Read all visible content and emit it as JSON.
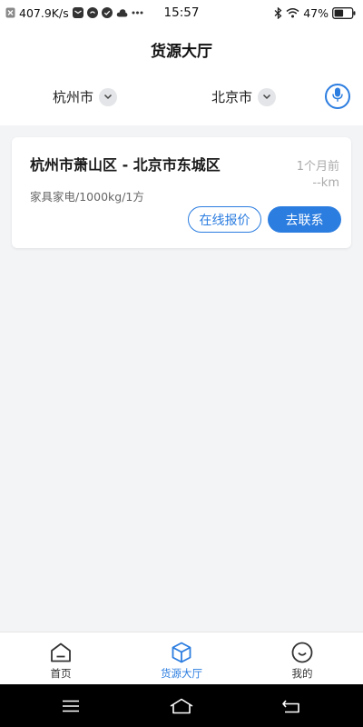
{
  "status_bar": {
    "net_speed": "407.9K/s",
    "time": "15:57",
    "battery": "47%",
    "icons": [
      "x-notification-icon",
      "mail-icon",
      "chat-icon",
      "check-icon",
      "cloud-icon",
      "more-dots-icon",
      "bluetooth-icon",
      "wifi-icon",
      "battery-icon"
    ]
  },
  "header": {
    "title": "货源大厅",
    "from_city": "杭州市",
    "to_city": "北京市",
    "mic_icon": "microphone-icon"
  },
  "listing": {
    "route": "杭州市萧山区 - 北京市东城区",
    "time_ago": "1个月前",
    "distance": "--km",
    "cargo": "家具家电/1000kg/1方",
    "quote_label": "在线报价",
    "contact_label": "去联系"
  },
  "tabbar": {
    "items": [
      {
        "label": "首页",
        "icon": "home-icon",
        "active": false
      },
      {
        "label": "货源大厅",
        "icon": "box-icon",
        "active": true
      },
      {
        "label": "我的",
        "icon": "smile-icon",
        "active": false
      }
    ]
  },
  "navbar": {
    "icons": [
      "menu-icon",
      "home-outline-icon",
      "back-icon"
    ]
  },
  "colors": {
    "accent": "#2b7de0",
    "background": "#f3f4f6",
    "card": "#ffffff",
    "muted_text": "#aaaaaa"
  }
}
